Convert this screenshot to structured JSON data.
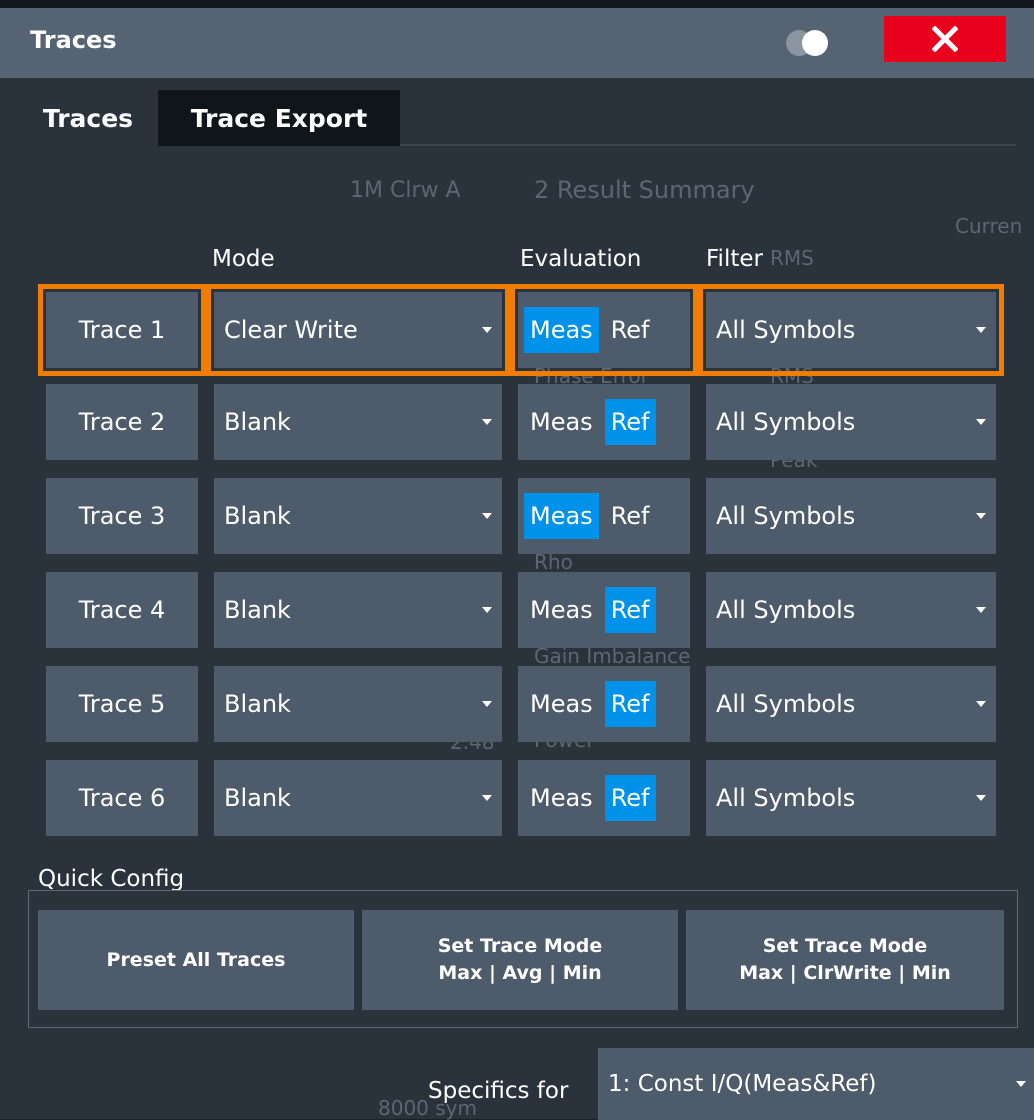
{
  "window": {
    "title": "Traces"
  },
  "tabs": [
    {
      "label": "Traces",
      "active": true
    },
    {
      "label": "Trace Export",
      "active": false
    }
  ],
  "columns": {
    "mode": "Mode",
    "evaluation": "Evaluation",
    "filter": "Filter"
  },
  "traces": [
    {
      "label": "Trace 1",
      "mode": "Clear Write",
      "meas": "Meas",
      "ref": "Ref",
      "eval_selected": "Meas",
      "filter": "All Symbols"
    },
    {
      "label": "Trace 2",
      "mode": "Blank",
      "meas": "Meas",
      "ref": "Ref",
      "eval_selected": "Ref",
      "filter": "All Symbols"
    },
    {
      "label": "Trace 3",
      "mode": "Blank",
      "meas": "Meas",
      "ref": "Ref",
      "eval_selected": "Meas",
      "filter": "All Symbols"
    },
    {
      "label": "Trace 4",
      "mode": "Blank",
      "meas": "Meas",
      "ref": "Ref",
      "eval_selected": "Ref",
      "filter": "All Symbols"
    },
    {
      "label": "Trace 5",
      "mode": "Blank",
      "meas": "Meas",
      "ref": "Ref",
      "eval_selected": "Ref",
      "filter": "All Symbols"
    },
    {
      "label": "Trace 6",
      "mode": "Blank",
      "meas": "Meas",
      "ref": "Ref",
      "eval_selected": "Ref",
      "filter": "All Symbols"
    }
  ],
  "quick_config": {
    "label": "Quick Config",
    "preset_all": "Preset All Traces",
    "avg_line1": "Set Trace Mode",
    "avg_line2": "Max | Avg | Min",
    "clrwrite_line1": "Set Trace Mode",
    "clrwrite_line2": "Max | ClrWrite | Min"
  },
  "specifics": {
    "label": "Specifics for",
    "value": "1: Const I/Q(Meas&Ref)"
  },
  "background_text": {
    "trace_info": "1M Clrw A",
    "result_summary": "2 Result Summary",
    "current": "Curren",
    "rms": "RMS",
    "phase_error": "Phase Error",
    "rms2": "RMS",
    "peak": "Peak",
    "rho": "Rho",
    "gain_imbalance": "Gain Imbalance",
    "power": "Power",
    "value_248": "2.48",
    "sym": "8000 sym"
  },
  "colors": {
    "accent": "#0091ea",
    "selection": "#f07d00",
    "close": "#e8001c"
  }
}
